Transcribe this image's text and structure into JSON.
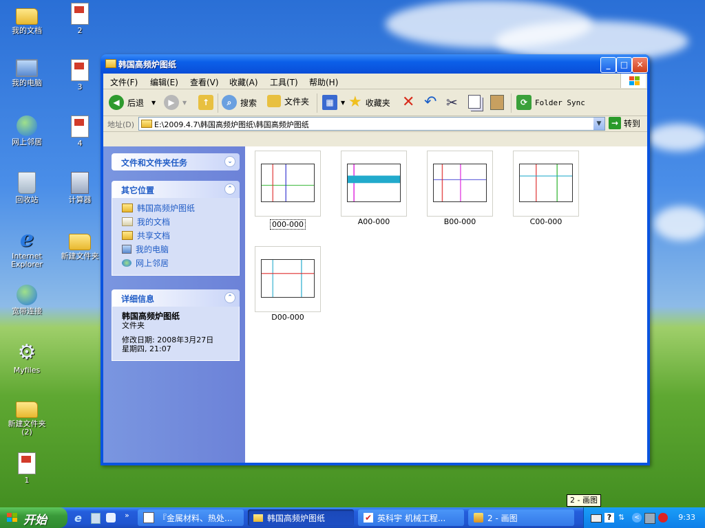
{
  "desktop": {
    "icons": [
      {
        "label": "我的文档"
      },
      {
        "label": "我的电脑"
      },
      {
        "label": "网上邻居"
      },
      {
        "label": "回收站"
      },
      {
        "label": "Internet Explorer"
      },
      {
        "label": "宽带连接"
      },
      {
        "label": "Myfiles"
      },
      {
        "label": "新建文件夹 (2)"
      },
      {
        "label": "1"
      },
      {
        "label": "2"
      },
      {
        "label": "3"
      },
      {
        "label": "4"
      },
      {
        "label": "计算器"
      },
      {
        "label": "新建文件夹"
      }
    ]
  },
  "window": {
    "title": "韩国高频炉图纸",
    "menu": [
      "文件(F)",
      "编辑(E)",
      "查看(V)",
      "收藏(A)",
      "工具(T)",
      "帮助(H)"
    ],
    "toolbar": {
      "back": "后退",
      "search": "搜索",
      "folders": "文件夹",
      "favorites": "收藏夹",
      "folder_sync": "Folder Sync"
    },
    "address": {
      "label": "地址(D)",
      "value": "E:\\2009.4.7\\韩国高频炉图纸\\韩国高频炉图纸",
      "go": "转到"
    },
    "left_pane": {
      "tasks_title": "文件和文件夹任务",
      "other_title": "其它位置",
      "other_links": [
        "韩国高频炉图纸",
        "我的文档",
        "共享文档",
        "我的电脑",
        "网上邻居"
      ],
      "details_title": "详细信息",
      "details_name": "韩国高频炉图纸",
      "details_type": "文件夹",
      "details_modified_line1": "修改日期: 2008年3月27日",
      "details_modified_line2": "星期四, 21:07"
    },
    "files": [
      {
        "name": "000-000",
        "selected": true
      },
      {
        "name": "A00-000",
        "selected": false
      },
      {
        "name": "B00-000",
        "selected": false
      },
      {
        "name": "C00-000",
        "selected": false
      },
      {
        "name": "D00-000",
        "selected": false
      }
    ]
  },
  "taskbar": {
    "start": "开始",
    "tasks": [
      {
        "label": "『金属材料、热处...",
        "active": false
      },
      {
        "label": "韩国高频炉图纸",
        "active": true
      },
      {
        "label": "英科宇 机械工程...",
        "active": false
      },
      {
        "label": "2 - 画图",
        "active": false
      }
    ],
    "tooltip": "2 - 画图",
    "clock": "9:33"
  }
}
